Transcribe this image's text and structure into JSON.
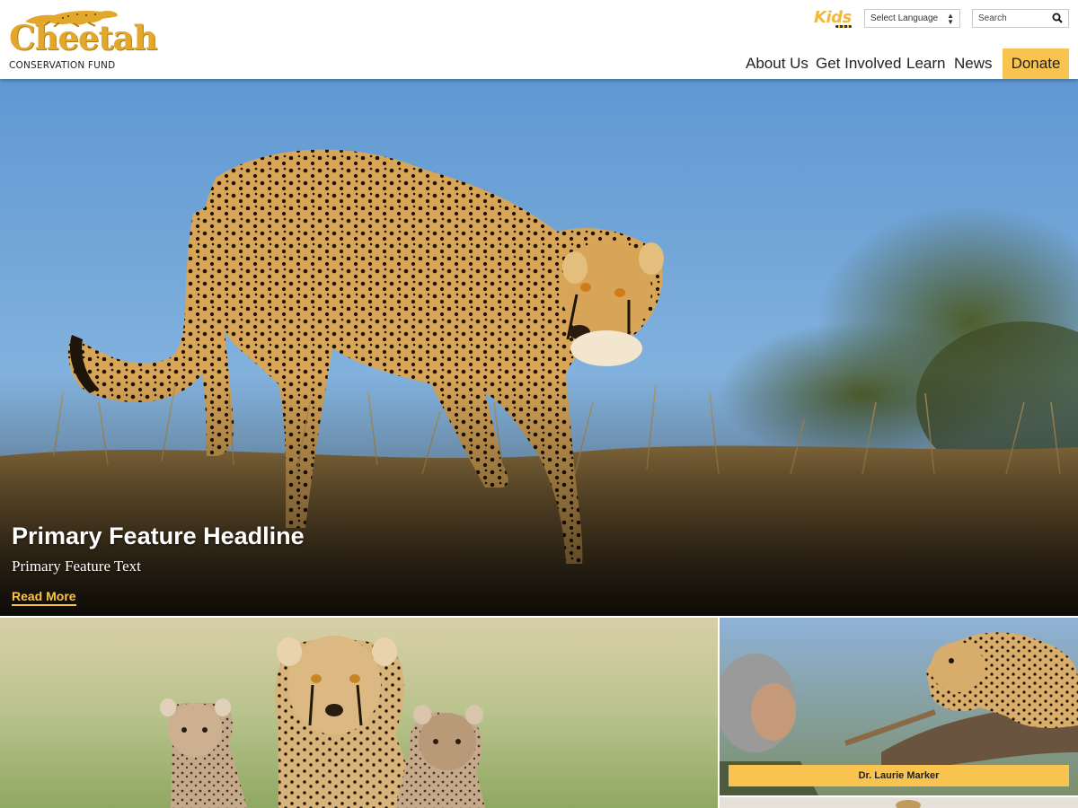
{
  "header": {
    "logo": {
      "word": "Cheetah",
      "subtitle": "CONSERVATION FUND"
    },
    "kids_label": "Kids",
    "language_select": {
      "value": "Select Language"
    },
    "search": {
      "placeholder": "Search",
      "icon": "search-icon"
    }
  },
  "nav": {
    "items": [
      {
        "label": "About Us"
      },
      {
        "label": "Get Involved"
      },
      {
        "label": "Learn"
      },
      {
        "label": "News"
      }
    ],
    "donate_label": "Donate"
  },
  "hero": {
    "headline": "Primary Feature Headline",
    "text": "Primary Feature Text",
    "link_label": "Read More"
  },
  "tiles": {
    "right": {
      "label": "Dr. Laurie Marker"
    }
  },
  "colors": {
    "accent": "#f8c44f",
    "logo_gold": "#e3a82b",
    "sky": "#6fa3d6"
  }
}
